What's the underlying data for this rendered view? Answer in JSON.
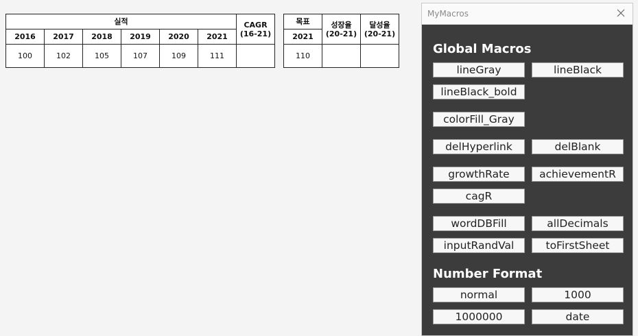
{
  "table_actual": {
    "group_header": "실적",
    "years": [
      "2016",
      "2017",
      "2018",
      "2019",
      "2020",
      "2021"
    ],
    "values": [
      "100",
      "102",
      "105",
      "107",
      "109",
      "111"
    ],
    "cagr_line1": "CAGR",
    "cagr_line2": "(16-21)"
  },
  "table_target": {
    "target_header": "목표",
    "target_year": "2021",
    "target_value": "110",
    "growth_line1": "성장율",
    "growth_line2": "(20-21)",
    "achieve_line1": "달성율",
    "achieve_line2": "(20-21)"
  },
  "panel": {
    "title": "MyMacros",
    "global_title": "Global Macros",
    "global_buttons": [
      "lineGray",
      "lineBlack",
      "lineBlack_bold",
      "colorFill_Gray",
      "delHyperlink",
      "delBlank",
      "growthRate",
      "achievementR",
      "cagR",
      "wordDBFill",
      "allDecimals",
      "inputRandVal",
      "toFirstSheet"
    ],
    "number_title": "Number Format",
    "number_buttons": [
      "normal",
      "1000",
      "1000000",
      "date"
    ]
  }
}
